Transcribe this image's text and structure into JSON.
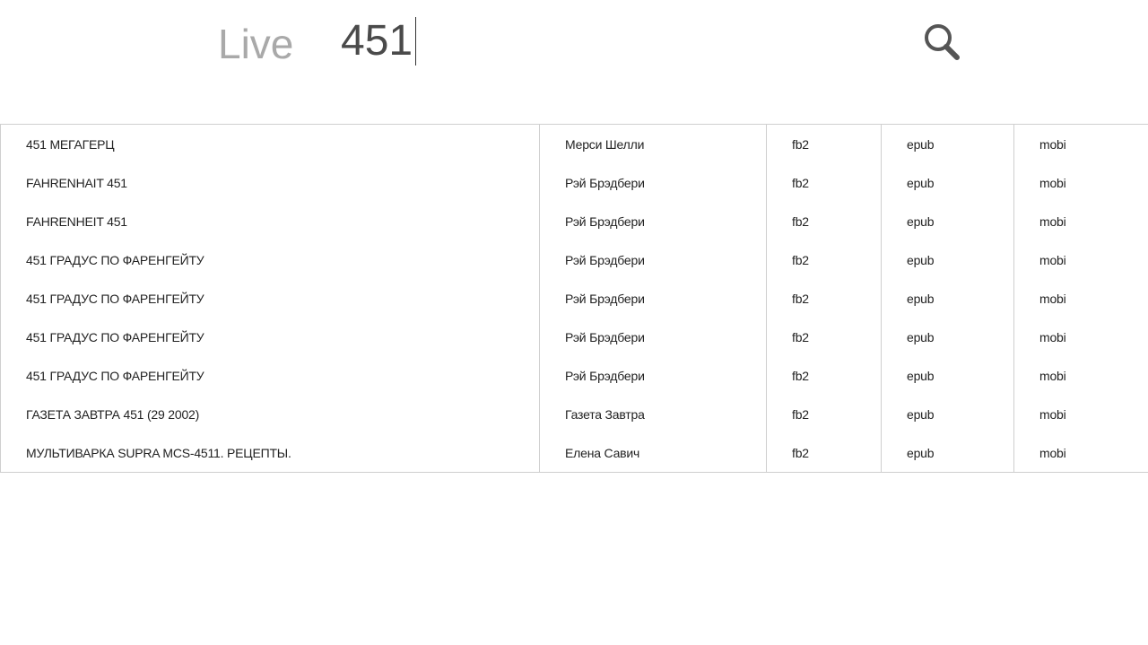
{
  "search": {
    "brand": "Live",
    "query": "451",
    "button_icon": "search-icon"
  },
  "results": [
    {
      "title": "451 МЕГАГЕРЦ",
      "author": "Мерси Шелли",
      "fb2": "fb2",
      "epub": "epub",
      "mobi": "mobi"
    },
    {
      "title": "FAHRENHAIT 451",
      "author": "Рэй Брэдбери",
      "fb2": "fb2",
      "epub": "epub",
      "mobi": "mobi"
    },
    {
      "title": "FAHRENHEIT 451",
      "author": "Рэй Брэдбери",
      "fb2": "fb2",
      "epub": "epub",
      "mobi": "mobi"
    },
    {
      "title": "451 ГРАДУС ПО ФАРЕНГЕЙТУ",
      "author": "Рэй Брэдбери",
      "fb2": "fb2",
      "epub": "epub",
      "mobi": "mobi"
    },
    {
      "title": "451 ГРАДУС ПО ФАРЕНГЕЙТУ",
      "author": "Рэй Брэдбери",
      "fb2": "fb2",
      "epub": "epub",
      "mobi": "mobi"
    },
    {
      "title": "451 ГРАДУС ПО ФАРЕНГЕЙТУ",
      "author": "Рэй Брэдбери",
      "fb2": "fb2",
      "epub": "epub",
      "mobi": "mobi"
    },
    {
      "title": "451 ГРАДУС ПО ФАРЕНГЕЙТУ",
      "author": "Рэй Брэдбери",
      "fb2": "fb2",
      "epub": "epub",
      "mobi": "mobi"
    },
    {
      "title": "ГАЗЕТА ЗАВТРА 451 (29 2002)",
      "author": "Газета Завтра",
      "fb2": "fb2",
      "epub": "epub",
      "mobi": "mobi"
    },
    {
      "title": "МУЛЬТИВАРКА SUPRA MCS-4511. РЕЦЕПТЫ.",
      "author": "Елена Савич",
      "fb2": "fb2",
      "epub": "epub",
      "mobi": "mobi"
    }
  ],
  "colors": {
    "brand_text": "#a9a9a9",
    "query_text": "#4a4a4a",
    "border": "#cfcfcf",
    "body_text": "#222222",
    "icon": "#555555"
  }
}
